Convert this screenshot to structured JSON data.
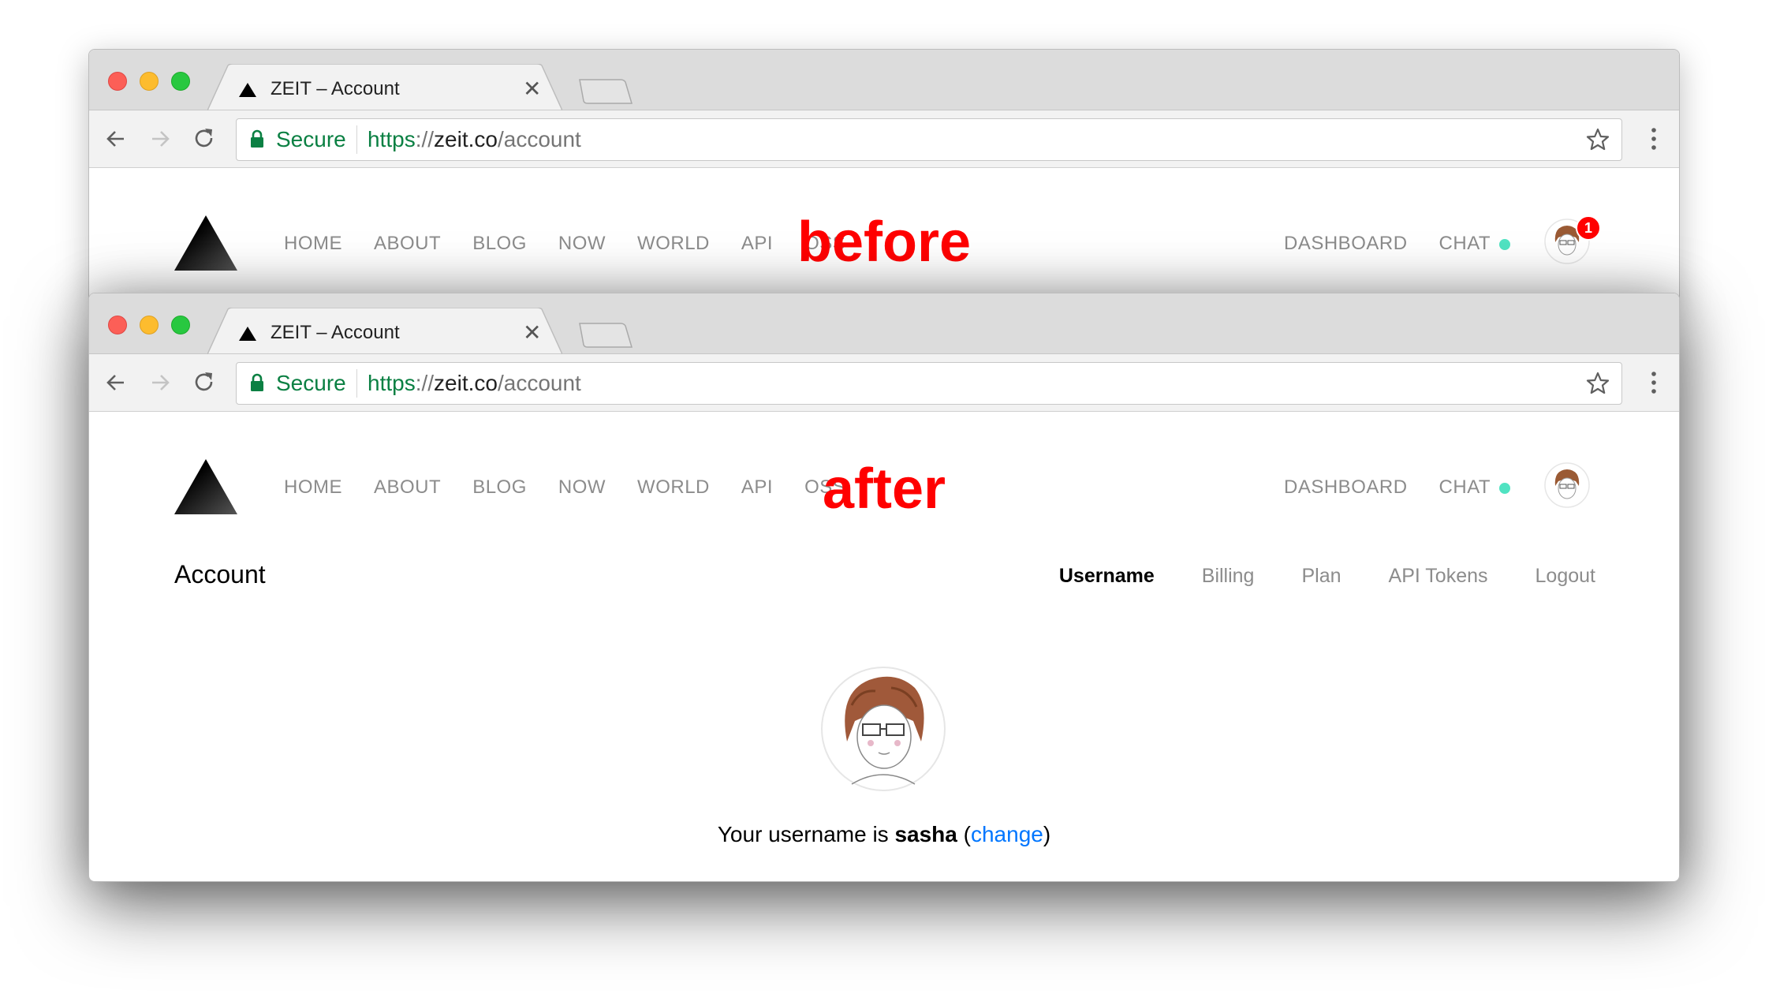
{
  "browser": {
    "tab_title": "ZEIT – Account",
    "secure_label": "Secure",
    "url": {
      "scheme": "https",
      "separator": "://",
      "host": "zeit.co",
      "path": "/account"
    }
  },
  "site": {
    "main_nav": [
      "HOME",
      "ABOUT",
      "BLOG",
      "NOW",
      "WORLD",
      "API",
      "OSS"
    ],
    "right_nav": {
      "dashboard": "DASHBOARD",
      "chat": "CHAT"
    },
    "notification_count": "1",
    "online_dot_color": "#50e3c2"
  },
  "annotations": {
    "before": "before",
    "after": "after"
  },
  "account": {
    "title": "Account",
    "tabs": [
      {
        "label": "Username",
        "active": true
      },
      {
        "label": "Billing",
        "active": false
      },
      {
        "label": "Plan",
        "active": false
      },
      {
        "label": "API Tokens",
        "active": false
      },
      {
        "label": "Logout",
        "active": false
      }
    ],
    "username_prefix": "Your username is",
    "username": "sasha",
    "change_link": "change"
  },
  "colors": {
    "annotation": "#ff0000",
    "link": "#0076ff",
    "secure": "#0b8043"
  }
}
